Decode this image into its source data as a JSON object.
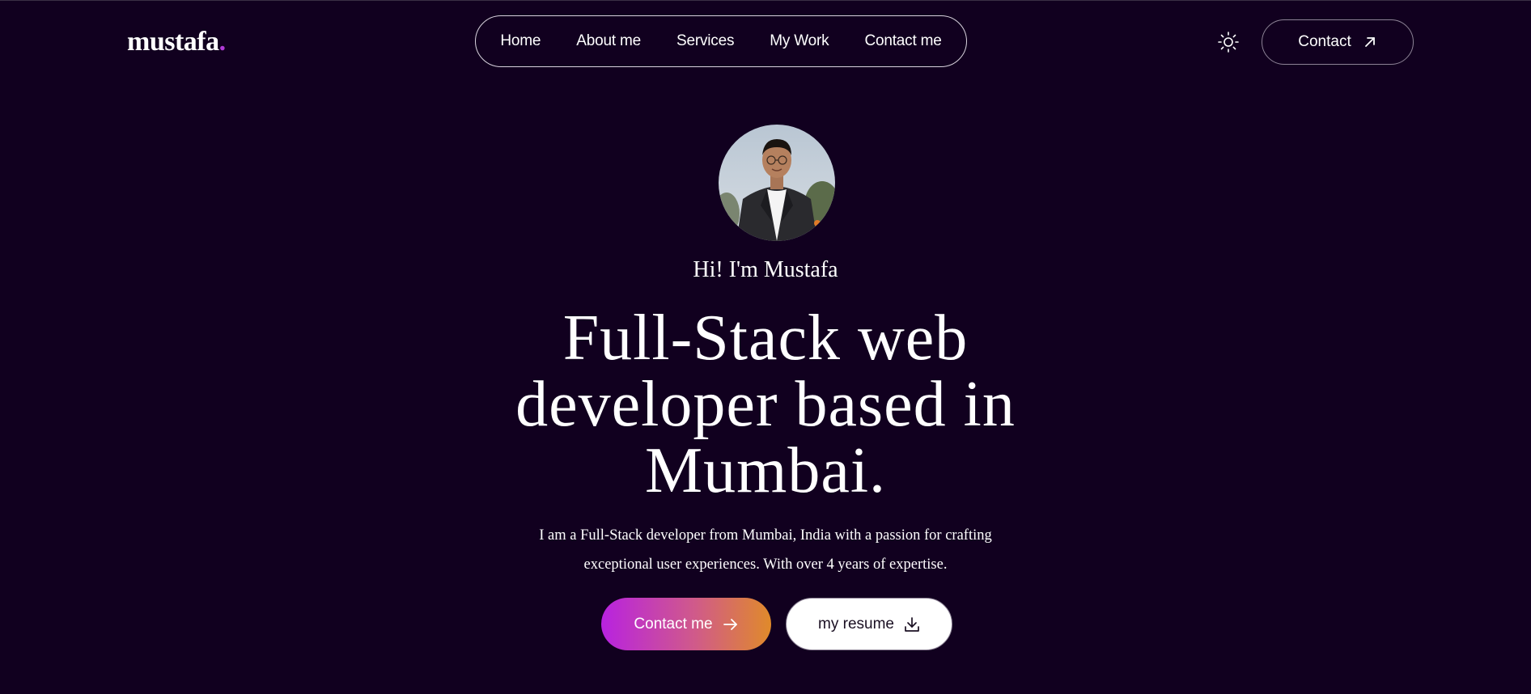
{
  "brand": {
    "name": "mustafa",
    "dot": ".",
    "dot_color": "#b23ad8"
  },
  "nav": {
    "items": [
      {
        "label": "Home"
      },
      {
        "label": "About me"
      },
      {
        "label": "Services"
      },
      {
        "label": "My Work"
      },
      {
        "label": "Contact me"
      }
    ]
  },
  "header": {
    "theme_icon": "sun-icon",
    "contact_label": "Contact",
    "contact_icon": "arrow-up-right-icon"
  },
  "hero": {
    "avatar_alt": "profile-photo",
    "greeting": "Hi! I'm Mustafa",
    "headline_line1": "Full-Stack web",
    "headline_line2": "developer based in",
    "headline_line3": "Mumbai.",
    "intro_line1": "I am a Full-Stack developer from Mumbai, India with a passion for crafting",
    "intro_line2": "exceptional user experiences. With over 4 years of expertise.",
    "primary_cta": "Contact me",
    "primary_cta_icon": "arrow-right-icon",
    "secondary_cta": "my resume",
    "secondary_cta_icon": "download-icon"
  },
  "colors": {
    "background": "#11001f",
    "gradient_start": "#b822e0",
    "gradient_end": "#e08a2a"
  }
}
